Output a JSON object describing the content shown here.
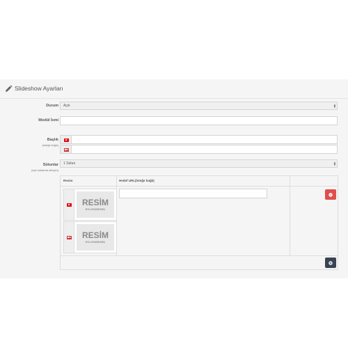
{
  "panel": {
    "title": "Slideshow Ayarları",
    "icon": "pencil-icon"
  },
  "form": {
    "status": {
      "label": "Durum",
      "value": "Açık"
    },
    "module_name": {
      "label": "Modül İsmi",
      "value": ""
    },
    "title": {
      "label": "Başlık",
      "help": "(İsteğe bağlı)",
      "languages": [
        "tr-flag-icon",
        "gb-flag-icon"
      ]
    },
    "columns": {
      "label": "Sütunlar",
      "help": "(eşit miktarda ekleyin)",
      "value": "1 Sütun"
    }
  },
  "table": {
    "headers": {
      "image": "Resim",
      "url": "Hedef URL(İsteğe bağlı)",
      "action": ""
    },
    "placeholder": {
      "line1": "RESİM",
      "line2": "EKLENMEMİŞ"
    },
    "colors": {
      "remove": "#e04e4e",
      "add": "#3a4351"
    }
  }
}
